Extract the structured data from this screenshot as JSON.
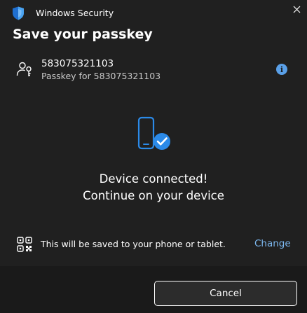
{
  "window": {
    "app_title": "Windows Security",
    "close_glyph": "✕"
  },
  "page": {
    "title": "Save your passkey"
  },
  "account": {
    "name": "583075321103",
    "subtitle": "Passkey for 583075321103",
    "info_glyph": "i",
    "icon": "person-key-icon"
  },
  "status": {
    "icon": "phone-check-icon",
    "line1": "Device connected!",
    "line2": "Continue on your device"
  },
  "save_location": {
    "icon": "qr-code-icon",
    "text": "This will be saved to your phone or tablet.",
    "change_label": "Change"
  },
  "footer": {
    "cancel_label": "Cancel"
  },
  "colors": {
    "background": "#202020",
    "footer_background": "#1a1a1a",
    "accent": "#0078d4",
    "link": "#7cb8f0",
    "info": "#5aa0e8"
  }
}
